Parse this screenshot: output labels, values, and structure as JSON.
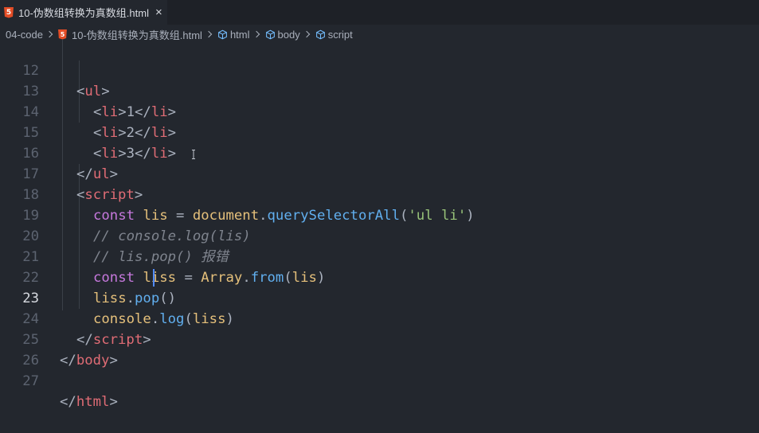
{
  "tab": {
    "filename": "10-伪数组转换为真数组.html",
    "icon": "html5-file-icon",
    "close_glyph": "×"
  },
  "breadcrumb": {
    "items": [
      {
        "label": "04-code",
        "icon": ""
      },
      {
        "label": "10-伪数组转换为真数组.html",
        "icon": "html5-file-icon"
      },
      {
        "label": "html",
        "icon": "cube-symbol-icon"
      },
      {
        "label": "body",
        "icon": "cube-symbol-icon"
      },
      {
        "label": "script",
        "icon": "cube-symbol-icon"
      }
    ]
  },
  "editor": {
    "active_line": 23,
    "lines": [
      {
        "num": "12",
        "tokens": [
          "<",
          "ul",
          ">"
        ]
      },
      {
        "num": "13",
        "tokens": [
          "<",
          "li",
          ">",
          "1",
          "</",
          "li",
          ">"
        ]
      },
      {
        "num": "14",
        "tokens": [
          "<",
          "li",
          ">",
          "2",
          "</",
          "li",
          ">"
        ]
      },
      {
        "num": "15",
        "tokens": [
          "<",
          "li",
          ">",
          "3",
          "</",
          "li",
          ">"
        ]
      },
      {
        "num": "16",
        "tokens": [
          "</",
          "ul",
          ">"
        ]
      },
      {
        "num": "17",
        "tokens": [
          "<",
          "script",
          ">"
        ]
      },
      {
        "num": "18",
        "tokens": [
          "const",
          " ",
          "lis",
          " = ",
          "document",
          ".",
          "querySelectorAll",
          "(",
          "'ul li'",
          ")"
        ]
      },
      {
        "num": "19",
        "tokens": [
          "// console.log(lis)"
        ]
      },
      {
        "num": "20",
        "tokens": [
          "// lis.pop() 报错"
        ]
      },
      {
        "num": "21",
        "tokens": [
          "const",
          " ",
          "liss",
          " = ",
          "Array",
          ".",
          "from",
          "(",
          "lis",
          ")"
        ]
      },
      {
        "num": "22",
        "tokens": [
          "liss",
          ".",
          "pop",
          "()"
        ]
      },
      {
        "num": "23",
        "tokens": [
          "console",
          ".",
          "log",
          "(",
          "liss",
          ")"
        ]
      },
      {
        "num": "24",
        "tokens": [
          "</",
          "script",
          ">"
        ]
      },
      {
        "num": "25",
        "tokens": [
          "</",
          "body",
          ">"
        ]
      },
      {
        "num": "26",
        "tokens": []
      },
      {
        "num": "27",
        "tokens": [
          "</",
          "html",
          ">"
        ]
      }
    ]
  },
  "colors": {
    "background": "#23272e",
    "tag": "#e06c75",
    "keyword": "#c678dd",
    "variable": "#e5c07b",
    "function": "#61afef",
    "string": "#98c379",
    "comment": "#7f848e",
    "cursor": "#528bff"
  }
}
